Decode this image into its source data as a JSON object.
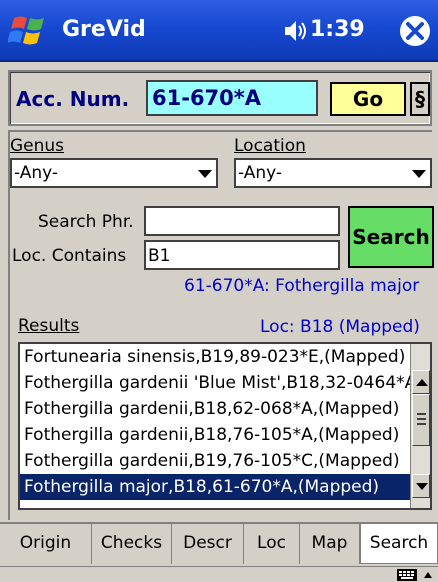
{
  "titlebar": {
    "app_title": "GreVid",
    "clock": "1:39"
  },
  "accession": {
    "label": "Acc. Num.",
    "value": "61-670*A",
    "go_label": "Go",
    "section_label": "§"
  },
  "filters": {
    "genus_label": "Genus",
    "genus_value": "-Any-",
    "location_label": "Location",
    "location_value": "-Any-",
    "search_phrase_label": "Search Phr.",
    "search_phrase_value": "",
    "loc_contains_label": "Loc. Contains",
    "loc_contains_value": "B1",
    "search_button": "Search"
  },
  "selected_info": "61-670*A: Fothergilla major",
  "results": {
    "label": "Results",
    "loc_info": "Loc: B18 (Mapped)",
    "items": [
      "Fortunearia sinensis,B19,89-023*E,(Mapped)",
      "Fothergilla gardenii 'Blue Mist',B18,32-0464*A",
      "Fothergilla gardenii,B18,62-068*A,(Mapped)",
      "Fothergilla gardenii,B18,76-105*A,(Mapped)",
      "Fothergilla gardenii,B19,76-105*C,(Mapped)",
      "Fothergilla major,B18,61-670*A,(Mapped)"
    ],
    "selected_index": 5
  },
  "tabs": [
    "Origin",
    "Checks",
    "Descr",
    "Loc",
    "Map",
    "Search"
  ],
  "active_tab": "Search",
  "colors": {
    "titlebar": "#1749d0",
    "accession_field": "#99ffff",
    "go_button": "#ffff99",
    "search_button": "#66dd66",
    "info_text": "#0000cc",
    "selection": "#0a246a"
  },
  "icons": [
    "windows-start-icon",
    "speaker-icon",
    "close-icon",
    "keyboard-icon",
    "caret-up-icon"
  ]
}
